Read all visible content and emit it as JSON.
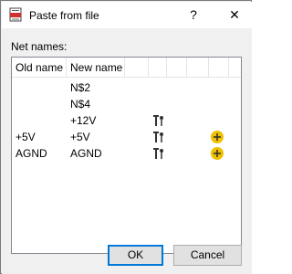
{
  "window": {
    "title": "Paste from file",
    "help_label": "?",
    "close_label": "✕"
  },
  "net_names_label": "Net names:",
  "table": {
    "columns": [
      "Old name",
      "New name",
      "",
      "",
      "",
      "",
      ""
    ],
    "rows": [
      {
        "old": "",
        "new": "N$2",
        "pin_icon": false,
        "add_icon": false
      },
      {
        "old": "",
        "new": "N$4",
        "pin_icon": false,
        "add_icon": false
      },
      {
        "old": "",
        "new": "+12V",
        "pin_icon": true,
        "add_icon": false
      },
      {
        "old": "+5V",
        "new": "+5V",
        "pin_icon": true,
        "add_icon": true
      },
      {
        "old": "AGND",
        "new": "AGND",
        "pin_icon": true,
        "add_icon": true
      }
    ]
  },
  "buttons": {
    "ok": "OK",
    "cancel": "Cancel"
  },
  "colors": {
    "add_icon": "#f0c000",
    "border": "#828790",
    "default_button_border": "#0078d7"
  },
  "icons": {
    "app": "paste-from-file-icon",
    "pin": "supply-pin-icon",
    "add": "add-circle-icon"
  }
}
